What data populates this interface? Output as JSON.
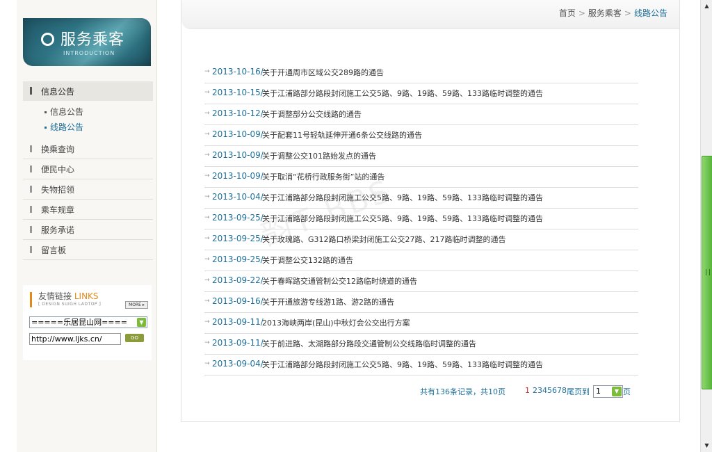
{
  "sidebar": {
    "banner": {
      "title": "服务乘客",
      "subtitle": "INTRODUCTION"
    },
    "active_menu": "信息公告",
    "submenu": [
      "信息公告",
      "线路公告"
    ],
    "menu": [
      "换乘查询",
      "便民中心",
      "失物招领",
      "乘车规章",
      "服务承诺",
      "留言板"
    ],
    "links": {
      "title": "友情链接",
      "title_en": "LINKS",
      "desc": "[ DESIGN SUIGH LADTOP ]",
      "more": "MORE",
      "select_value": "=====乐居昆山网====",
      "url_value": "http://www.ljks.cn/",
      "go": "GO"
    }
  },
  "breadcrumb": {
    "home": "首页",
    "section": "服务乘客",
    "current": "线路公告",
    "sep": ">"
  },
  "notices": [
    {
      "date": "2013-10-16/",
      "title": "关于开通周市区域公交289路的通告"
    },
    {
      "date": "2013-10-15/",
      "title": "关于江浦路部分路段封闭施工公交5路、9路、19路、59路、133路临时调整的通告"
    },
    {
      "date": "2013-10-12/",
      "title": "关于调整部分公交线路的通告"
    },
    {
      "date": "2013-10-09/",
      "title": "关于配套11号轻轨延伸开通6条公交线路的通告"
    },
    {
      "date": "2013-10-09/",
      "title": "关于调整公交101路始发点的通告"
    },
    {
      "date": "2013-10-09/",
      "title": "关于取消“花桥行政服务街”站的通告"
    },
    {
      "date": "2013-10-04/",
      "title": "关于江浦路部分路段封闭施工公交5路、9路、19路、59路、133路临时调整的通告"
    },
    {
      "date": "2013-09-25/",
      "title": "关于江浦路部分路段封闭施工公交5路、9路、19路、59路、133路临时调整的通告"
    },
    {
      "date": "2013-09-25/",
      "title": "关于玫瑰路、G312路口桥梁封闭施工公交27路、217路临时调整的通告"
    },
    {
      "date": "2013-09-25/",
      "title": "关于调整公交132路的通告"
    },
    {
      "date": "2013-09-22/",
      "title": "关于春晖路交通管制公交12路临时绕道的通告"
    },
    {
      "date": "2013-09-16/",
      "title": "关于开通旅游专线游1路、游2路的通告"
    },
    {
      "date": "2013-09-11/",
      "title": "2013海峡两岸(昆山)中秋灯会公交出行方案"
    },
    {
      "date": "2013-09-11/",
      "title": "关于前进路、太湖路部分路段交通管制公交线路临时调整的通告"
    },
    {
      "date": "2013-09-04/",
      "title": "关于江浦路部分路段封闭施工公交5路、9路、19路、59路、133路临时调整的通告"
    }
  ],
  "pager": {
    "total": "共有136条记录，共10页",
    "current": "1",
    "pages": "2345678",
    "last": "尾页到",
    "select_value": "1",
    "page": "页"
  },
  "watermark": "韵Ƭ BBS",
  "colors": {
    "accent": "#1d6f9a",
    "link_orange": "#e08a1a",
    "scroll_green": "#52b335"
  }
}
